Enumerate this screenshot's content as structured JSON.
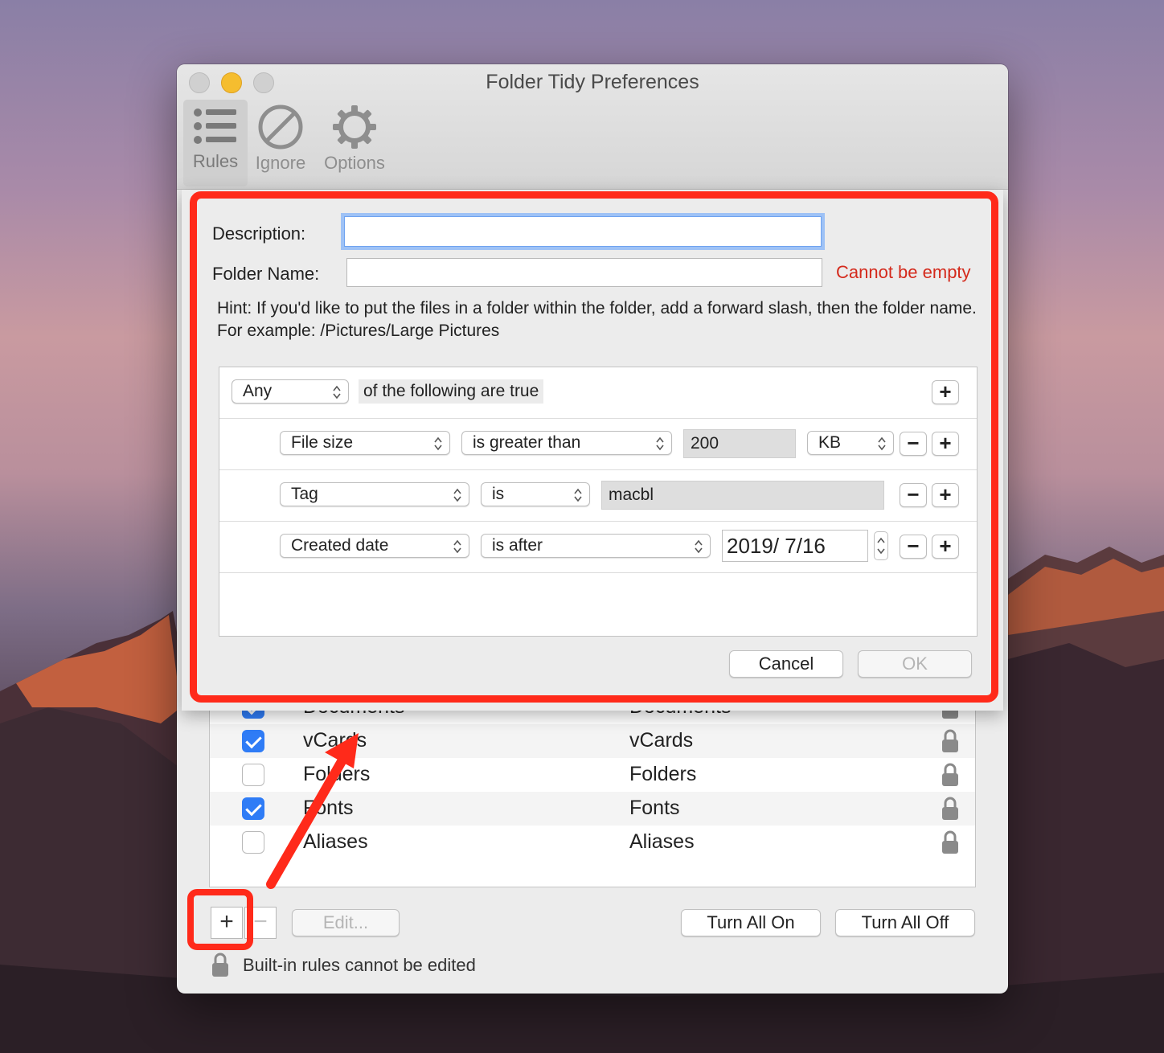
{
  "window": {
    "title": "Folder Tidy Preferences",
    "toolbar": [
      {
        "label": "Rules",
        "icon": "list-icon",
        "active": true
      },
      {
        "label": "Ignore",
        "icon": "prohibited-icon",
        "active": false
      },
      {
        "label": "Options",
        "icon": "gear-icon",
        "active": false
      }
    ]
  },
  "sheet": {
    "description_label": "Description:",
    "description_value": "",
    "folder_name_label": "Folder Name:",
    "folder_name_value": "",
    "folder_name_error": "Cannot be empty",
    "hint": "Hint: If you'd like to put the files in a folder within the folder, add a forward slash, then the folder name.  For example: /Pictures/Large Pictures",
    "match_mode": "Any",
    "match_suffix": "of the following are true",
    "criteria": [
      {
        "attribute": "File size",
        "operator": "is greater than",
        "value": "200",
        "unit": "KB"
      },
      {
        "attribute": "Tag",
        "operator": "is",
        "value": "macbl"
      },
      {
        "attribute": "Created date",
        "operator": "is after",
        "value": "2019/  7/16"
      }
    ],
    "cancel_label": "Cancel",
    "ok_label": "OK",
    "plus_glyph": "+",
    "minus_glyph": "−"
  },
  "rules_list": [
    {
      "enabled": true,
      "name": "Documents",
      "folder": "Documents"
    },
    {
      "enabled": true,
      "name": "vCards",
      "folder": "vCards"
    },
    {
      "enabled": false,
      "name": "Folders",
      "folder": "Folders"
    },
    {
      "enabled": true,
      "name": "Fonts",
      "folder": "Fonts"
    },
    {
      "enabled": false,
      "name": "Aliases",
      "folder": "Aliases"
    }
  ],
  "bottom_bar": {
    "add_glyph": "+",
    "remove_glyph": "−",
    "edit_label": "Edit...",
    "turn_all_on_label": "Turn All On",
    "turn_all_off_label": "Turn All Off",
    "note": "Built-in rules cannot be edited"
  },
  "colors": {
    "highlight": "#ff2a1a",
    "checkbox_on": "#2f7cf6",
    "error": "#d42a1c"
  }
}
